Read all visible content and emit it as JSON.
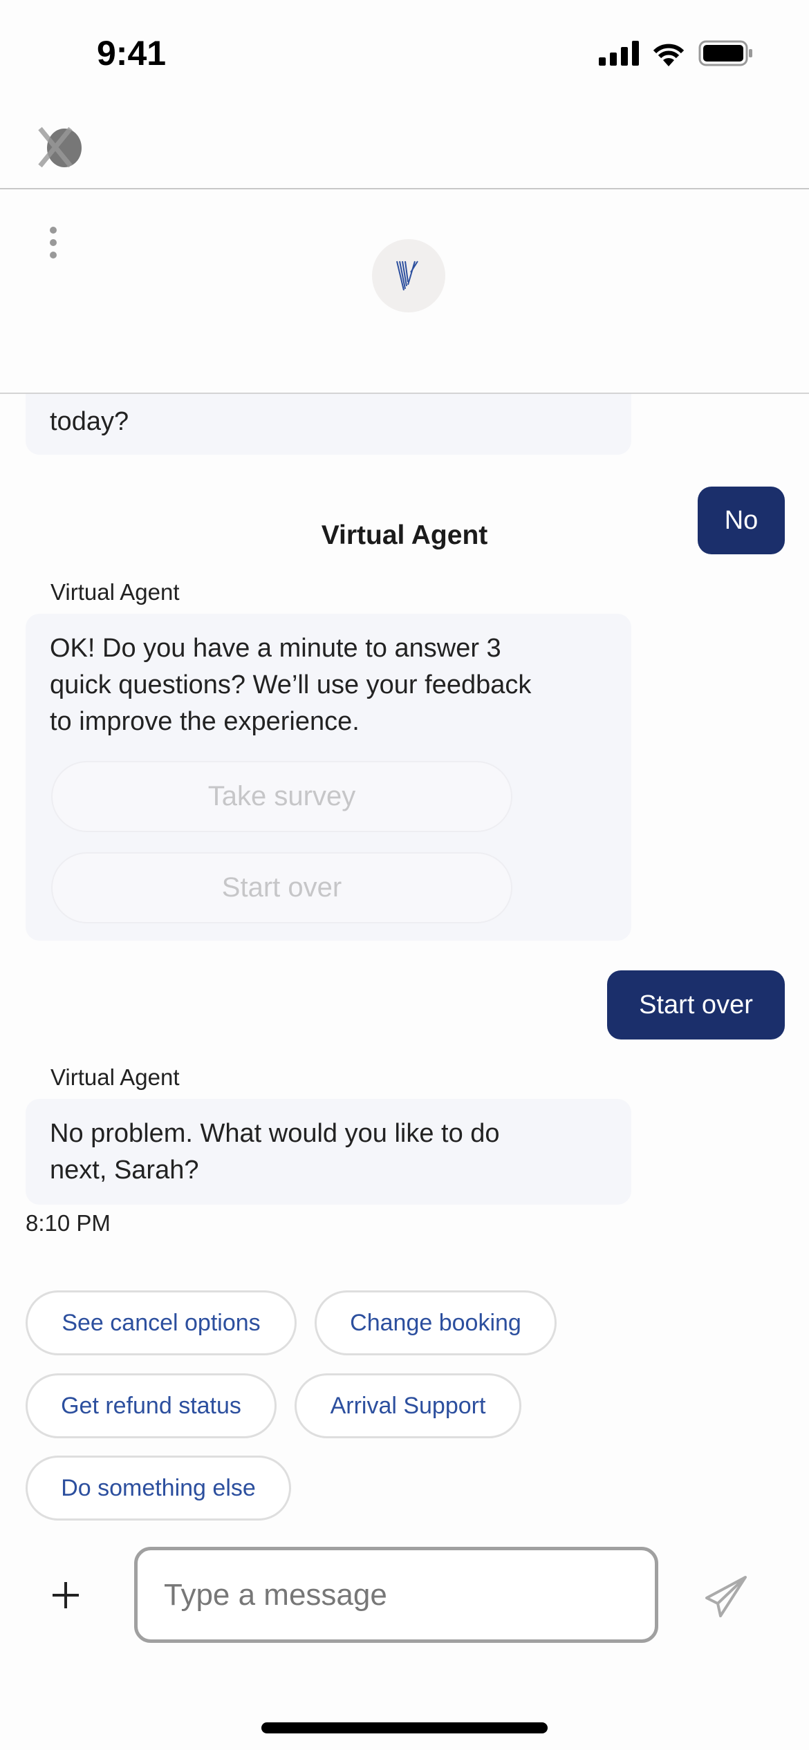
{
  "status_bar": {
    "time": "9:41"
  },
  "header": {
    "title": "Virtual Agent"
  },
  "messages": {
    "partial_agent_text": "today?",
    "user_1": "No",
    "agent_label": "Virtual Agent",
    "agent_2_lines": [
      "OK! Do you have a minute to answer 3",
      "quick questions? We’ll use your feedback",
      "to improve the experience."
    ],
    "agent_2_buttons": [
      "Take survey",
      "Start over"
    ],
    "user_2": "Start over",
    "agent_3_lines": [
      "No problem. What would you like to do",
      "next, Sarah?"
    ],
    "timestamp": "8:10 PM"
  },
  "quick_replies": [
    "See cancel options",
    "Change booking",
    "Get refund status",
    "Arrival Support",
    "Do something else"
  ],
  "composer": {
    "placeholder": "Type a message"
  },
  "colors": {
    "user_bubble": "#1b2f6b",
    "chip_text": "#2c4f9e",
    "agent_bubble": "#f5f6fa"
  }
}
